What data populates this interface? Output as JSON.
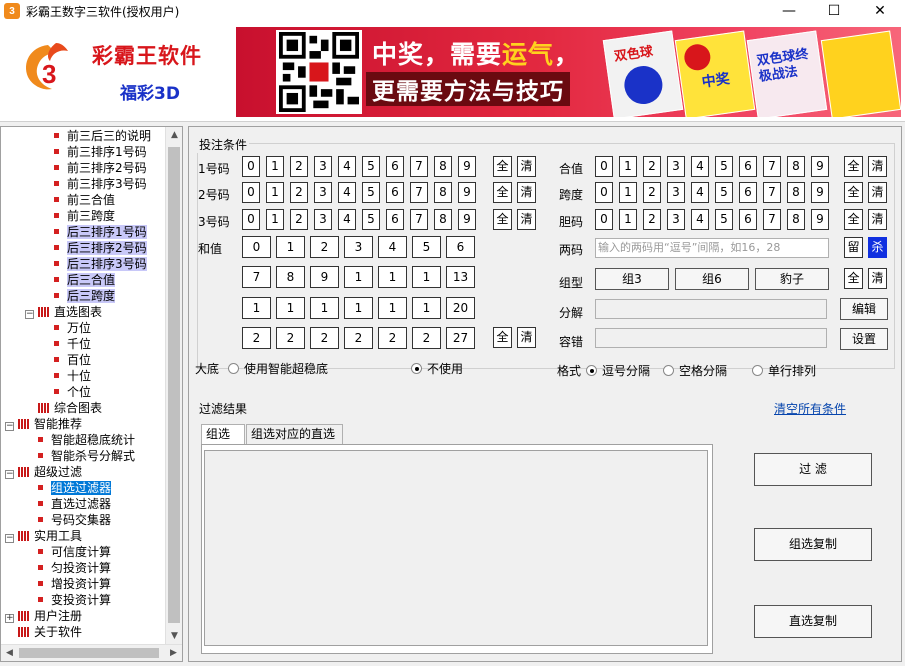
{
  "window": {
    "title": "彩霸王数字三软件(授权用户)",
    "controls": {
      "minimize": "—",
      "maximize": "☐",
      "close": "✕"
    }
  },
  "header": {
    "brand_title": "彩霸王软件",
    "brand_sub": "福彩3D",
    "banner_line1_a": "中奖，需要",
    "banner_line1_b": "运气",
    "banner_line1_c": "，",
    "banner_line2": "更需要方法与技巧",
    "book1": "双色球",
    "book2": "中奖",
    "book3": "双色球终极战法"
  },
  "tree": {
    "items": [
      {
        "label": "前三后三的说明",
        "type": "leaf",
        "indent": 3,
        "state": ""
      },
      {
        "label": "前三排序1号码",
        "type": "leaf",
        "indent": 3,
        "state": ""
      },
      {
        "label": "前三排序2号码",
        "type": "leaf",
        "indent": 3,
        "state": ""
      },
      {
        "label": "前三排序3号码",
        "type": "leaf",
        "indent": 3,
        "state": ""
      },
      {
        "label": "前三合值",
        "type": "leaf",
        "indent": 3,
        "state": ""
      },
      {
        "label": "前三跨度",
        "type": "leaf",
        "indent": 3,
        "state": ""
      },
      {
        "label": "后三排序1号码",
        "type": "leaf",
        "indent": 3,
        "state": "hl"
      },
      {
        "label": "后三排序2号码",
        "type": "leaf",
        "indent": 3,
        "state": "hl"
      },
      {
        "label": "后三排序3号码",
        "type": "leaf",
        "indent": 3,
        "state": "hl"
      },
      {
        "label": "后三合值",
        "type": "leaf",
        "indent": 3,
        "state": "hl"
      },
      {
        "label": "后三跨度",
        "type": "leaf",
        "indent": 3,
        "state": "hl"
      },
      {
        "label": "直选图表",
        "type": "folder",
        "indent": 1,
        "state": ""
      },
      {
        "label": "万位",
        "type": "leaf",
        "indent": 3,
        "state": ""
      },
      {
        "label": "千位",
        "type": "leaf",
        "indent": 3,
        "state": ""
      },
      {
        "label": "百位",
        "type": "leaf",
        "indent": 3,
        "state": ""
      },
      {
        "label": "十位",
        "type": "leaf",
        "indent": 3,
        "state": ""
      },
      {
        "label": "个位",
        "type": "leaf",
        "indent": 3,
        "state": ""
      },
      {
        "label": "综合图表",
        "type": "folder-leaf",
        "indent": 1,
        "state": ""
      },
      {
        "label": "智能推荐",
        "type": "folder",
        "indent": 0,
        "state": ""
      },
      {
        "label": "智能超稳底统计",
        "type": "leaf",
        "indent": 2,
        "state": ""
      },
      {
        "label": "智能杀号分解式",
        "type": "leaf",
        "indent": 2,
        "state": ""
      },
      {
        "label": "超级过滤",
        "type": "folder",
        "indent": 0,
        "state": ""
      },
      {
        "label": "组选过滤器",
        "type": "leaf",
        "indent": 2,
        "state": "sel"
      },
      {
        "label": "直选过滤器",
        "type": "leaf",
        "indent": 2,
        "state": ""
      },
      {
        "label": "号码交集器",
        "type": "leaf",
        "indent": 2,
        "state": ""
      },
      {
        "label": "实用工具",
        "type": "folder",
        "indent": 0,
        "state": ""
      },
      {
        "label": "可信度计算",
        "type": "leaf",
        "indent": 2,
        "state": ""
      },
      {
        "label": "匀投资计算",
        "type": "leaf",
        "indent": 2,
        "state": ""
      },
      {
        "label": "增投资计算",
        "type": "leaf",
        "indent": 2,
        "state": ""
      },
      {
        "label": "变投资计算",
        "type": "leaf",
        "indent": 2,
        "state": ""
      },
      {
        "label": "用户注册",
        "type": "folder-plus",
        "indent": 0,
        "state": ""
      },
      {
        "label": "关于软件",
        "type": "folder-leaf",
        "indent": 0,
        "state": ""
      }
    ]
  },
  "conditions": {
    "title": "投注条件",
    "digits": [
      "0",
      "1",
      "2",
      "3",
      "4",
      "5",
      "6",
      "7",
      "8",
      "9"
    ],
    "all_label": "全",
    "clear_label": "清",
    "left_rows": [
      "1号码",
      "2号码",
      "3号码"
    ],
    "right_rows": [
      "合值",
      "跨度",
      "胆码"
    ],
    "sum_label": "和值",
    "sum_grid": [
      [
        "0",
        "1",
        "2",
        "3",
        "4",
        "5",
        "6"
      ],
      [
        "7",
        "8",
        "9",
        "1",
        "1",
        "1",
        "13"
      ],
      [
        "1",
        "1",
        "1",
        "1",
        "1",
        "1",
        "20"
      ],
      [
        "2",
        "2",
        "2",
        "2",
        "2",
        "2",
        "27"
      ]
    ],
    "pair_label": "两码",
    "pair_placeholder": "输入的两码用“逗号”间隔，如16，28",
    "keep_label": "留",
    "kill_label": "杀",
    "group_label": "组型",
    "group_options": [
      "组3",
      "组6",
      "豹子"
    ],
    "decomp_label": "分解",
    "edit_label": "编辑",
    "tolerance_label": "容错",
    "settings_label": "设置",
    "base_label": "大底",
    "base_opt1": "使用智能超稳底",
    "base_opt2": "不使用",
    "format_label": "格式",
    "format_opt1": "逗号分隔",
    "format_opt2": "空格分隔",
    "format_opt3": "单行排列"
  },
  "results": {
    "title": "过滤结果",
    "clear_all": "清空所有条件",
    "tab1": "组选",
    "tab2": "组选对应的直选",
    "btn_filter": "过  滤",
    "btn_copy_group": "组选复制",
    "btn_copy_direct": "直选复制"
  }
}
